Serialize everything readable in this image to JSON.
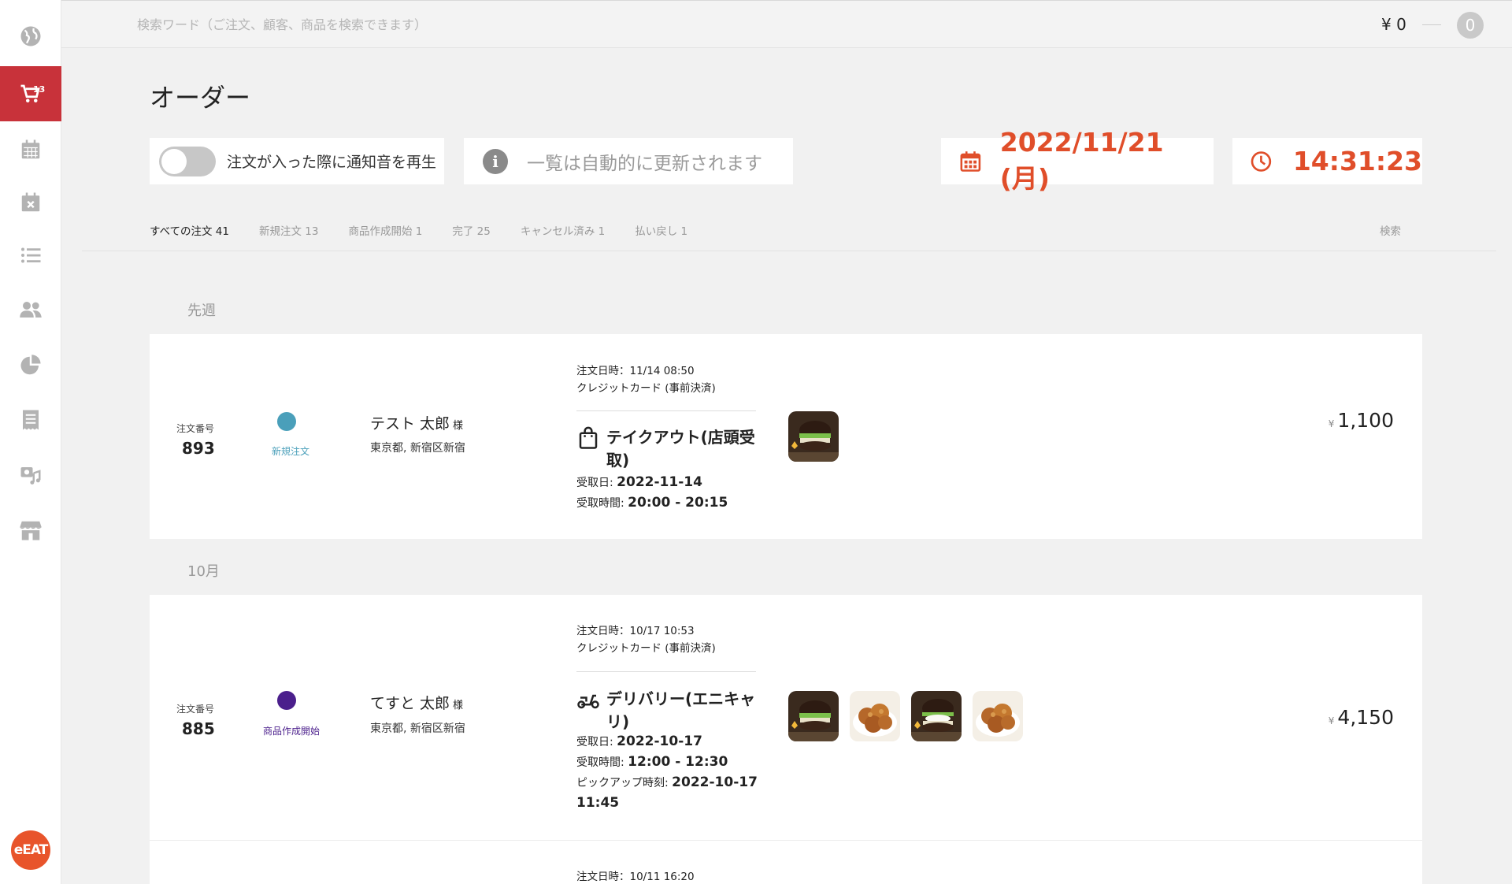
{
  "search": {
    "placeholder": "検索ワード（ご注文、顧客、商品を検索できます）"
  },
  "header": {
    "balance": "¥ 0",
    "notification_count": "0"
  },
  "sidebar": {
    "order_badge": "13",
    "items": [
      "globe-icon",
      "cart-icon",
      "calendar-icon",
      "calendar-cancel-icon",
      "list-icon",
      "users-icon",
      "pie-chart-icon",
      "receipt-icon",
      "printer-music-icon",
      "store-icon"
    ],
    "logo": "eEAT"
  },
  "page": {
    "title": "オーダー"
  },
  "controls": {
    "notify_sound_label": "注文が入った際に通知音を再生",
    "notify_sound_on": false,
    "auto_update_text": "一覧は自動的に更新されます",
    "date": "2022/11/21 (月)",
    "time": "14:31:23",
    "accent_color": "#e04e2a"
  },
  "tabs": [
    {
      "label": "すべての注文 41",
      "active": true
    },
    {
      "label": "新規注文 13",
      "active": false
    },
    {
      "label": "商品作成開始 1",
      "active": false
    },
    {
      "label": "完了 25",
      "active": false
    },
    {
      "label": "キャンセル済み 1",
      "active": false
    },
    {
      "label": "払い戻し 1",
      "active": false
    }
  ],
  "search_tab": "検索",
  "sections": [
    {
      "label": "先週",
      "orders": [
        {
          "number_label": "注文番号",
          "number": "893",
          "status": "新規注文",
          "status_color": "#4a9fba",
          "customer": "テスト 太郎",
          "honorific": "様",
          "address": "東京都, 新宿区新宿",
          "ordered_at": "注文日時：11/14 08:50",
          "payment": "クレジットカード (事前決済)",
          "type": "テイクアウト(店頭受取)",
          "type_icon": "shopping-bag-icon",
          "receive_date_label": "受取日:",
          "receive_date": "2022-11-14",
          "receive_time_label": "受取時間:",
          "receive_time": "20:00 - 20:15",
          "items": [
            "burger"
          ],
          "total_currency": "¥",
          "total": "1,100"
        }
      ]
    },
    {
      "label": "10月",
      "orders": [
        {
          "number_label": "注文番号",
          "number": "885",
          "status": "商品作成開始",
          "status_color": "#4b1f8c",
          "customer": "てすと 太郎",
          "honorific": "様",
          "address": "東京都, 新宿区新宿",
          "ordered_at": "注文日時：10/17 10:53",
          "payment": "クレジットカード (事前決済)",
          "type": "デリバリー(エニキャリ)",
          "type_icon": "scooter-icon",
          "receive_date_label": "受取日:",
          "receive_date": "2022-10-17",
          "receive_time_label": "受取時間:",
          "receive_time": "12:00 - 12:30",
          "pickup_label": "ピックアップ時刻:",
          "pickup_date": "2022-10-17",
          "pickup_time": "11:45",
          "items": [
            "burger",
            "karaage",
            "burger",
            "karaage"
          ],
          "total_currency": "¥",
          "total": "4,150"
        },
        {
          "ordered_at": "注文日時：10/11 16:20"
        }
      ]
    }
  ]
}
